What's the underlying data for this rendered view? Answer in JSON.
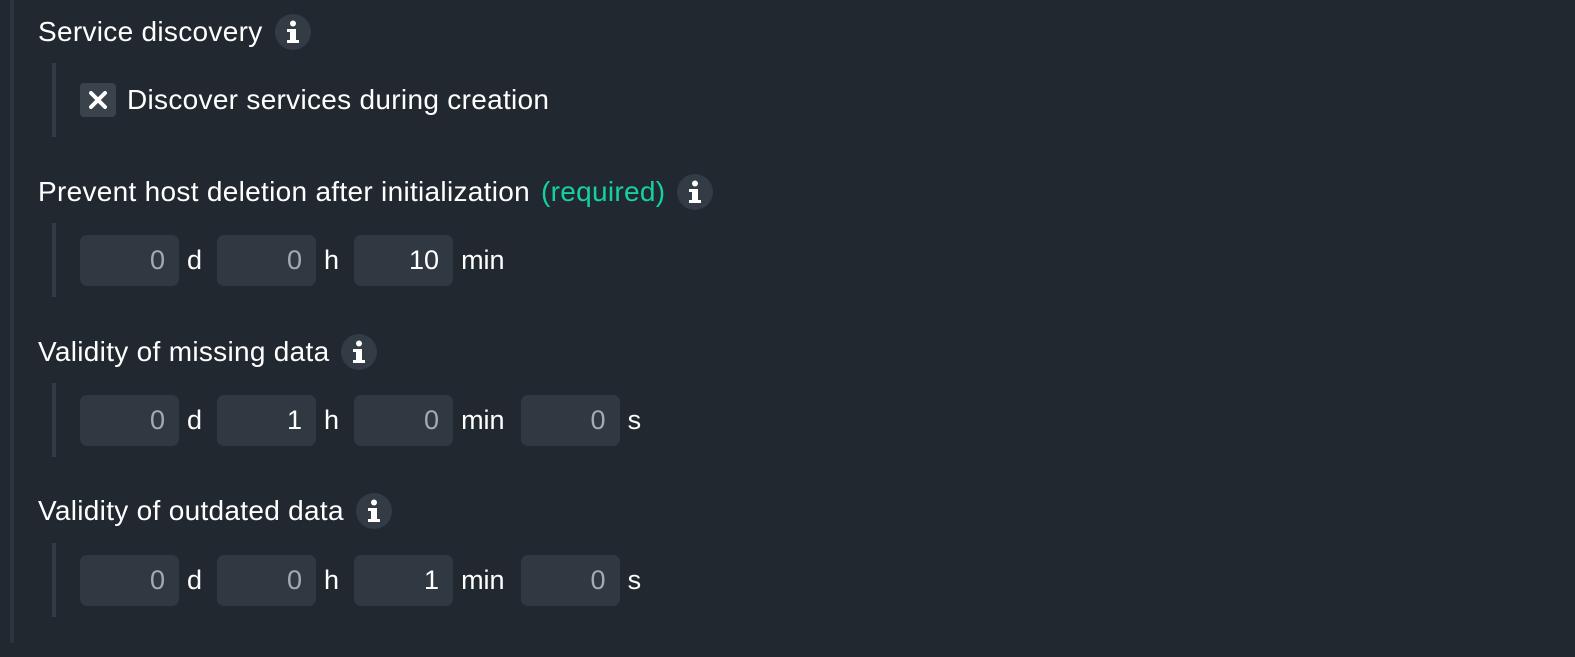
{
  "service_discovery": {
    "title": "Service discovery",
    "checkbox_label": "Discover services during creation",
    "checked": false
  },
  "prevent_deletion": {
    "title": "Prevent host deletion after initialization",
    "required": "(required)",
    "fields": [
      {
        "value": "0",
        "unit": "d"
      },
      {
        "value": "0",
        "unit": "h"
      },
      {
        "value": "10",
        "unit": "min"
      }
    ]
  },
  "missing_data": {
    "title": "Validity of missing data",
    "fields": [
      {
        "value": "0",
        "unit": "d"
      },
      {
        "value": "1",
        "unit": "h"
      },
      {
        "value": "0",
        "unit": "min"
      },
      {
        "value": "0",
        "unit": "s"
      }
    ]
  },
  "outdated_data": {
    "title": "Validity of outdated data",
    "fields": [
      {
        "value": "0",
        "unit": "d"
      },
      {
        "value": "0",
        "unit": "h"
      },
      {
        "value": "1",
        "unit": "min"
      },
      {
        "value": "0",
        "unit": "s"
      }
    ]
  },
  "icons": {
    "info": "info-icon",
    "checkbox": "close-x-icon"
  },
  "colors": {
    "background": "#212830",
    "input_bg": "#303842",
    "required": "#15d1a0",
    "text": "#ffffff",
    "zero_text": "#a6aab0"
  }
}
